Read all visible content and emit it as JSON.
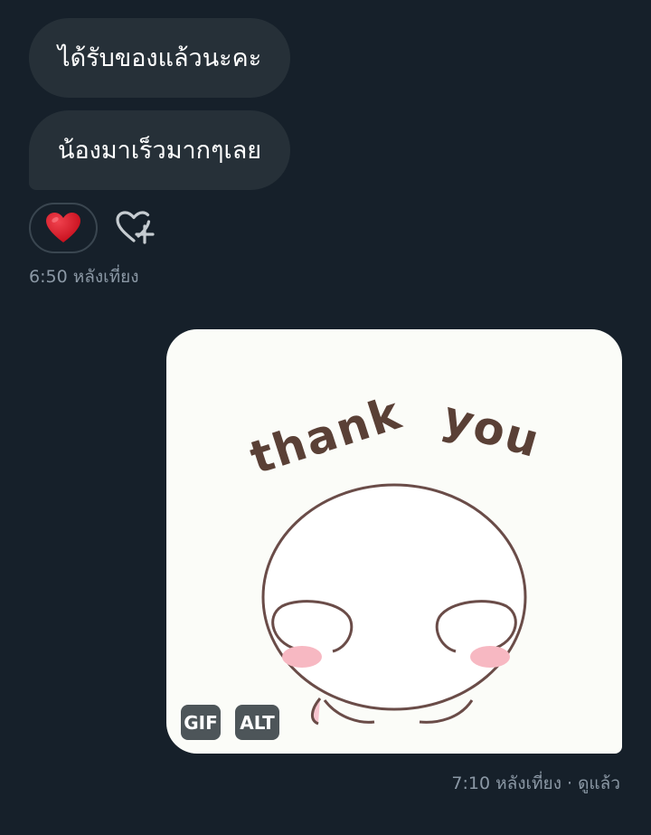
{
  "messages": [
    {
      "text": "ได้รับของแล้วนะคะ"
    },
    {
      "text": "น้องมาเร็วมากๆเลย"
    }
  ],
  "reactions": {
    "emoji": "❤",
    "add_icon": "heart-plus-icon"
  },
  "timestamps": {
    "received": "6:50 หลังเที่ยง",
    "sent": "7:10 หลังเที่ยง · ดูแล้ว"
  },
  "gif": {
    "caption_word_1": "thank",
    "caption_word_2": "you",
    "badge_gif": "GIF",
    "badge_alt": "ALT"
  },
  "colors": {
    "background": "#16202a",
    "bubble": "#263038",
    "timestamp": "#8b98a5",
    "heart": "#d81e2c",
    "badge": "#4d5559"
  }
}
